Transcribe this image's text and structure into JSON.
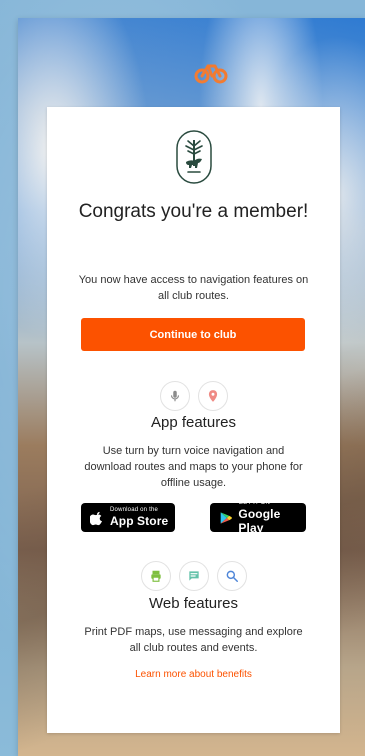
{
  "theme": {
    "accent": "#fc5200",
    "text": "#222222",
    "muted": "#333333",
    "background_overlay": "#ffffff"
  },
  "modal": {
    "title": "Congrats you're a member!",
    "subtitle": "You now have access to navigation features on all club routes.",
    "primary_button": "Continue to club",
    "app_section": {
      "title": "App features",
      "text": "Use turn by turn voice navigation and download routes and maps to your phone for offline usage.",
      "icons": [
        "microphone-icon",
        "location-pin-icon"
      ]
    },
    "badges": {
      "app_store_small": "Download on the",
      "app_store_big": "App Store",
      "play_small": "GET IT ON",
      "play_big": "Google Play"
    },
    "web_section": {
      "title": "Web features",
      "text": "Print PDF maps, use messaging and explore all club routes and events.",
      "icons": [
        "printer-icon",
        "chat-icon",
        "search-icon"
      ]
    },
    "learn_more": "Learn more about benefits"
  }
}
